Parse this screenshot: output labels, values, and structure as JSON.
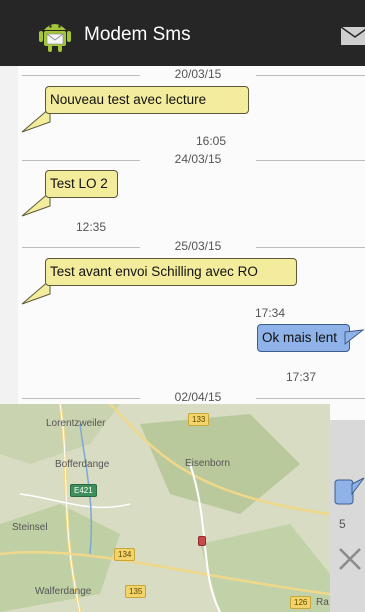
{
  "app": {
    "title": "Modem Sms"
  },
  "colors": {
    "appbar": "#262626",
    "incoming": "#f3ec9c",
    "outgoing": "#8fb2e8"
  },
  "icons": {
    "app": "android-icon",
    "compose": "envelope-icon",
    "close": "close-icon"
  },
  "thread": {
    "dates": [
      "20/03/15",
      "24/03/15",
      "25/03/15",
      "02/04/15"
    ],
    "messages": [
      {
        "text": "Nouveau test avec lecture",
        "time": "16:05",
        "direction": "incoming"
      },
      {
        "text": "Test LO 2",
        "time": "12:35",
        "direction": "incoming"
      },
      {
        "text": "Test avant envoi Schilling avec RO",
        "time": "17:34",
        "direction": "incoming"
      },
      {
        "text": "Ok mais lent",
        "time": "17:37",
        "direction": "outgoing"
      }
    ],
    "partial_time_fragment": "5"
  },
  "map": {
    "places": [
      "Lorentzweiler",
      "Bofferdange",
      "Eisenborn",
      "Steinsel",
      "Walferdange",
      "Ra"
    ],
    "roads": [
      "133",
      "E421",
      "134",
      "135",
      "126"
    ]
  }
}
